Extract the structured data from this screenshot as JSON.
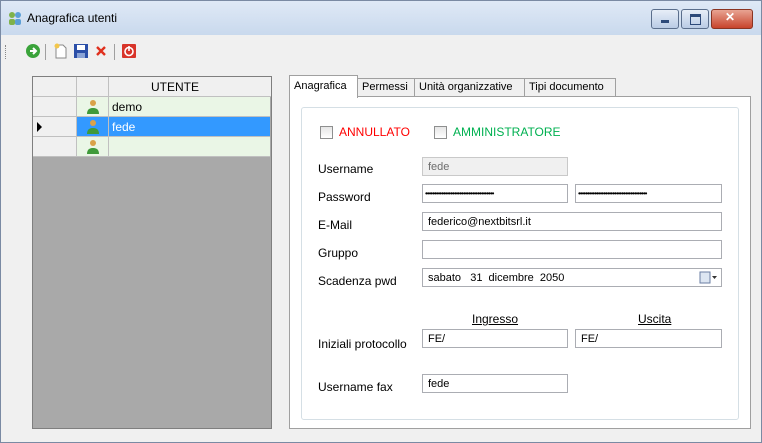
{
  "window": {
    "title": "Anagrafica utenti",
    "icon": "users-icon"
  },
  "toolbar": {
    "buttons": [
      {
        "name": "refresh-button",
        "icon": "green-arrow-circle-icon"
      },
      {
        "name": "new-button",
        "icon": "new-document-icon"
      },
      {
        "name": "save-button",
        "icon": "floppy-disk-icon"
      },
      {
        "name": "delete-button",
        "icon": "red-x-icon"
      },
      {
        "name": "close-button",
        "icon": "red-power-icon"
      }
    ]
  },
  "grid": {
    "column_header": "UTENTE",
    "rows": [
      {
        "name": "demo",
        "selected": false
      },
      {
        "name": "fede",
        "selected": true
      },
      {
        "name": "",
        "selected": false
      }
    ]
  },
  "tabs": [
    {
      "label": "Anagrafica",
      "active": true
    },
    {
      "label": "Permessi",
      "active": false
    },
    {
      "label": "Unità organizzative",
      "active": false
    },
    {
      "label": "Tipi documento",
      "active": false
    }
  ],
  "form": {
    "annullato_label": "ANNULLATO",
    "amministratore_label": "AMMINISTRATORE",
    "username_label": "Username",
    "username_value": "fede",
    "password_label": "Password",
    "password_mask": "••••••••••••••••••••••••••••••••••••••",
    "password_confirm_mask": "••••••••••••••••••••••••••••••••••••••",
    "email_label": "E-Mail",
    "email_value": "federico@nextbitsrl.it",
    "gruppo_label": "Gruppo",
    "gruppo_value": "",
    "scadenza_label": "Scadenza pwd",
    "scadenza_value": "sabato   31  dicembre  2050",
    "ingresso_header": "Ingresso",
    "uscita_header": "Uscita",
    "iniziali_label": "Iniziali protocollo",
    "iniziali_ingresso": "FE/",
    "iniziali_uscita": "FE/",
    "username_fax_label": "Username fax",
    "username_fax_value": "fede"
  },
  "colors": {
    "annullato": "#ff0000",
    "amministratore": "#00b050",
    "selection": "#3399ff",
    "row_bg": "#eaf6e6"
  }
}
